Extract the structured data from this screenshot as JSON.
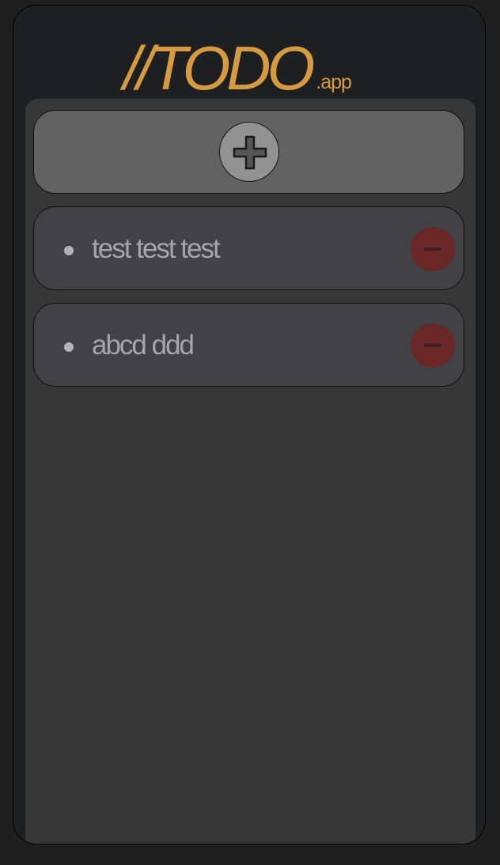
{
  "app": {
    "logo_main": "//TODO",
    "logo_sub": ".app",
    "accent_color": "#d79b3f"
  },
  "add": {
    "icon": "plus-icon"
  },
  "todos": [
    {
      "text": "test test test",
      "remove_icon": "minus-icon"
    },
    {
      "text": "abcd ddd",
      "remove_icon": "minus-icon"
    }
  ]
}
